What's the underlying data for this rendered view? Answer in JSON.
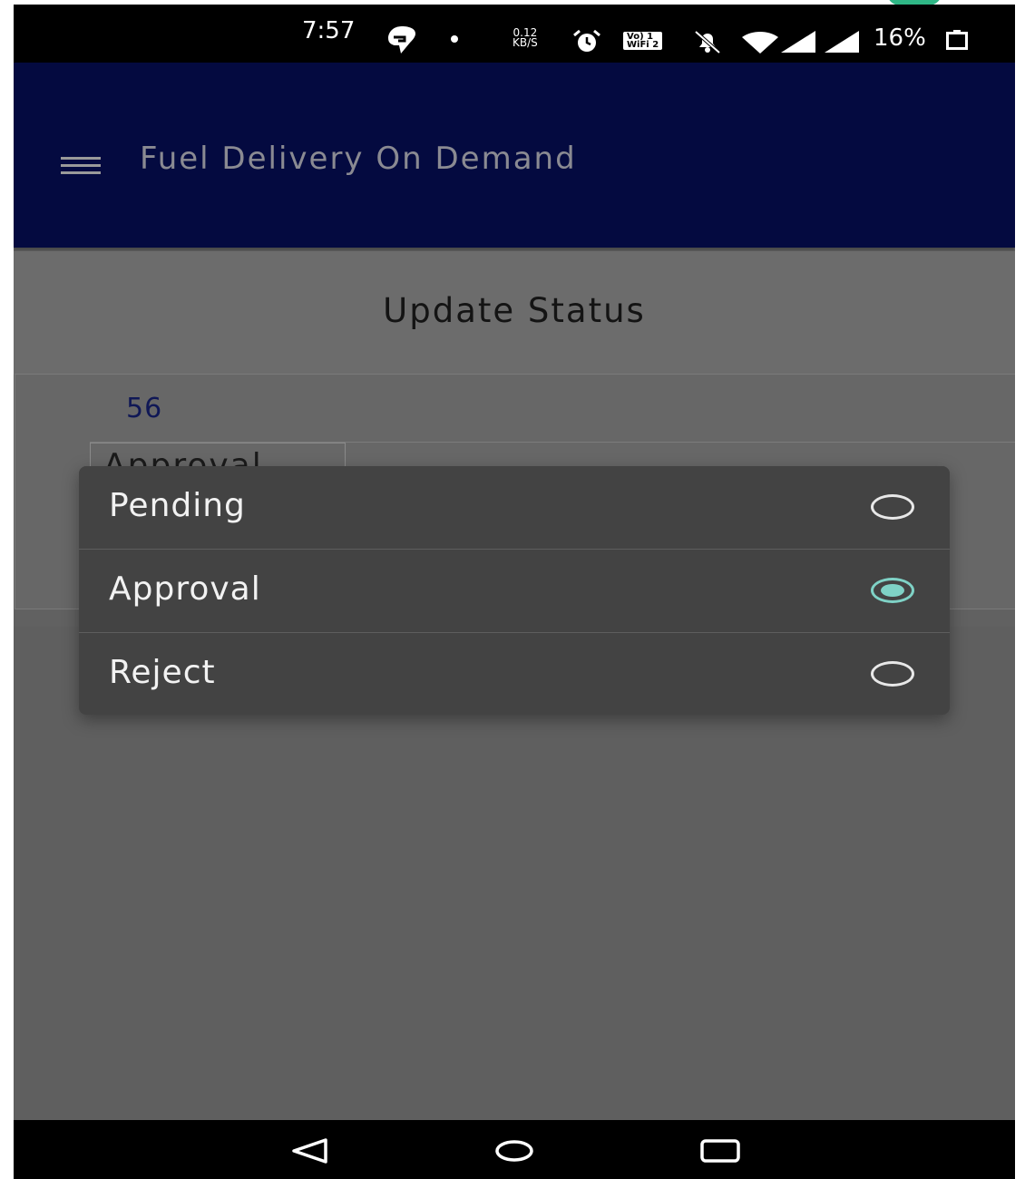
{
  "status_bar": {
    "time": "7:57",
    "network_speed_value": "0.12",
    "network_speed_unit": "KB/S",
    "wifi_badge_top": "Vo) 1",
    "wifi_badge_bottom": "WiFi 2",
    "battery_percent": "16%",
    "icons": [
      "swiggy-icon",
      "dot-icon",
      "alarm-icon",
      "vowifi-icon",
      "bell-off-icon",
      "wifi-icon",
      "signal-icon",
      "signal-icon",
      "battery-icon"
    ]
  },
  "app_bar": {
    "title": "Fuel Delivery On Demand",
    "menu_icon": "hamburger-menu-icon",
    "background": "#040a40"
  },
  "page": {
    "heading": "Update Status",
    "order_id": "56",
    "status_select_value": "Approval"
  },
  "dialog": {
    "options": [
      {
        "label": "Pending",
        "selected": false
      },
      {
        "label": "Approval",
        "selected": true
      },
      {
        "label": "Reject",
        "selected": false
      }
    ],
    "accent_color": "#7fd2c6"
  },
  "nav_bar": {
    "icons": [
      "back-icon",
      "home-icon",
      "recents-icon"
    ]
  }
}
